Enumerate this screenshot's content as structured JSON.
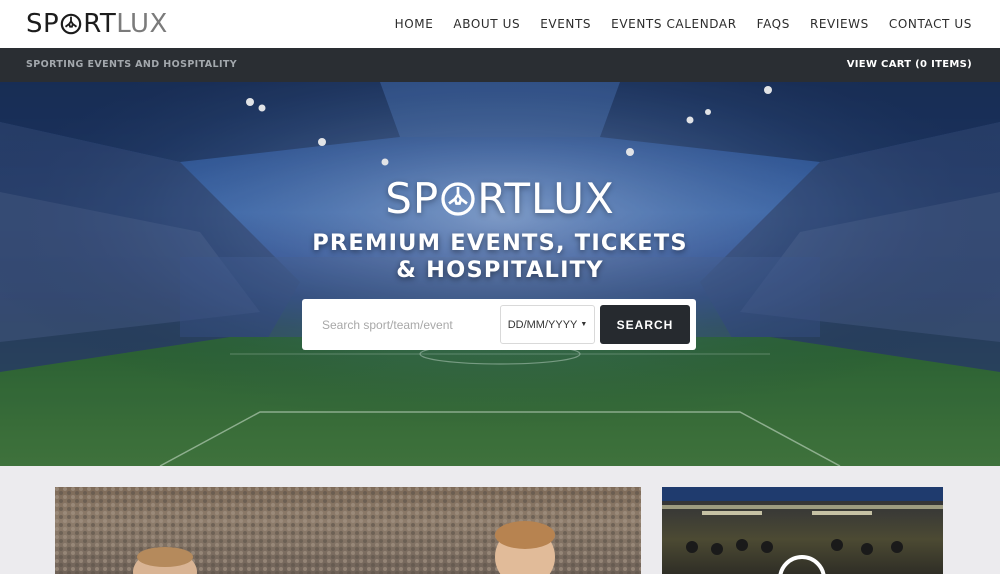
{
  "brand": {
    "logo_strong": "SPORT",
    "logo_light": "LUX"
  },
  "nav": {
    "items": [
      {
        "label": "HOME"
      },
      {
        "label": "ABOUT US"
      },
      {
        "label": "EVENTS"
      },
      {
        "label": "EVENTS CALENDAR"
      },
      {
        "label": "FAQS"
      },
      {
        "label": "REVIEWS"
      },
      {
        "label": "CONTACT US"
      }
    ]
  },
  "subbar": {
    "tagline": "SPORTING EVENTS AND HOSPITALITY",
    "cart_label": "VIEW CART (0 ITEMS)"
  },
  "hero": {
    "logo_strong": "SPORT",
    "logo_light": "LUX",
    "title_line1": "PREMIUM EVENTS, TICKETS",
    "title_line2": "& HOSPITALITY"
  },
  "search": {
    "placeholder": "Search sport/team/event",
    "value": "",
    "date_placeholder": "DD/MM/YYYY",
    "button_label": "SEARCH"
  },
  "colors": {
    "header_bg": "#ffffff",
    "subbar_bg": "#2a2e33",
    "button_bg": "#262a2f",
    "page_bg": "#ecebee"
  }
}
